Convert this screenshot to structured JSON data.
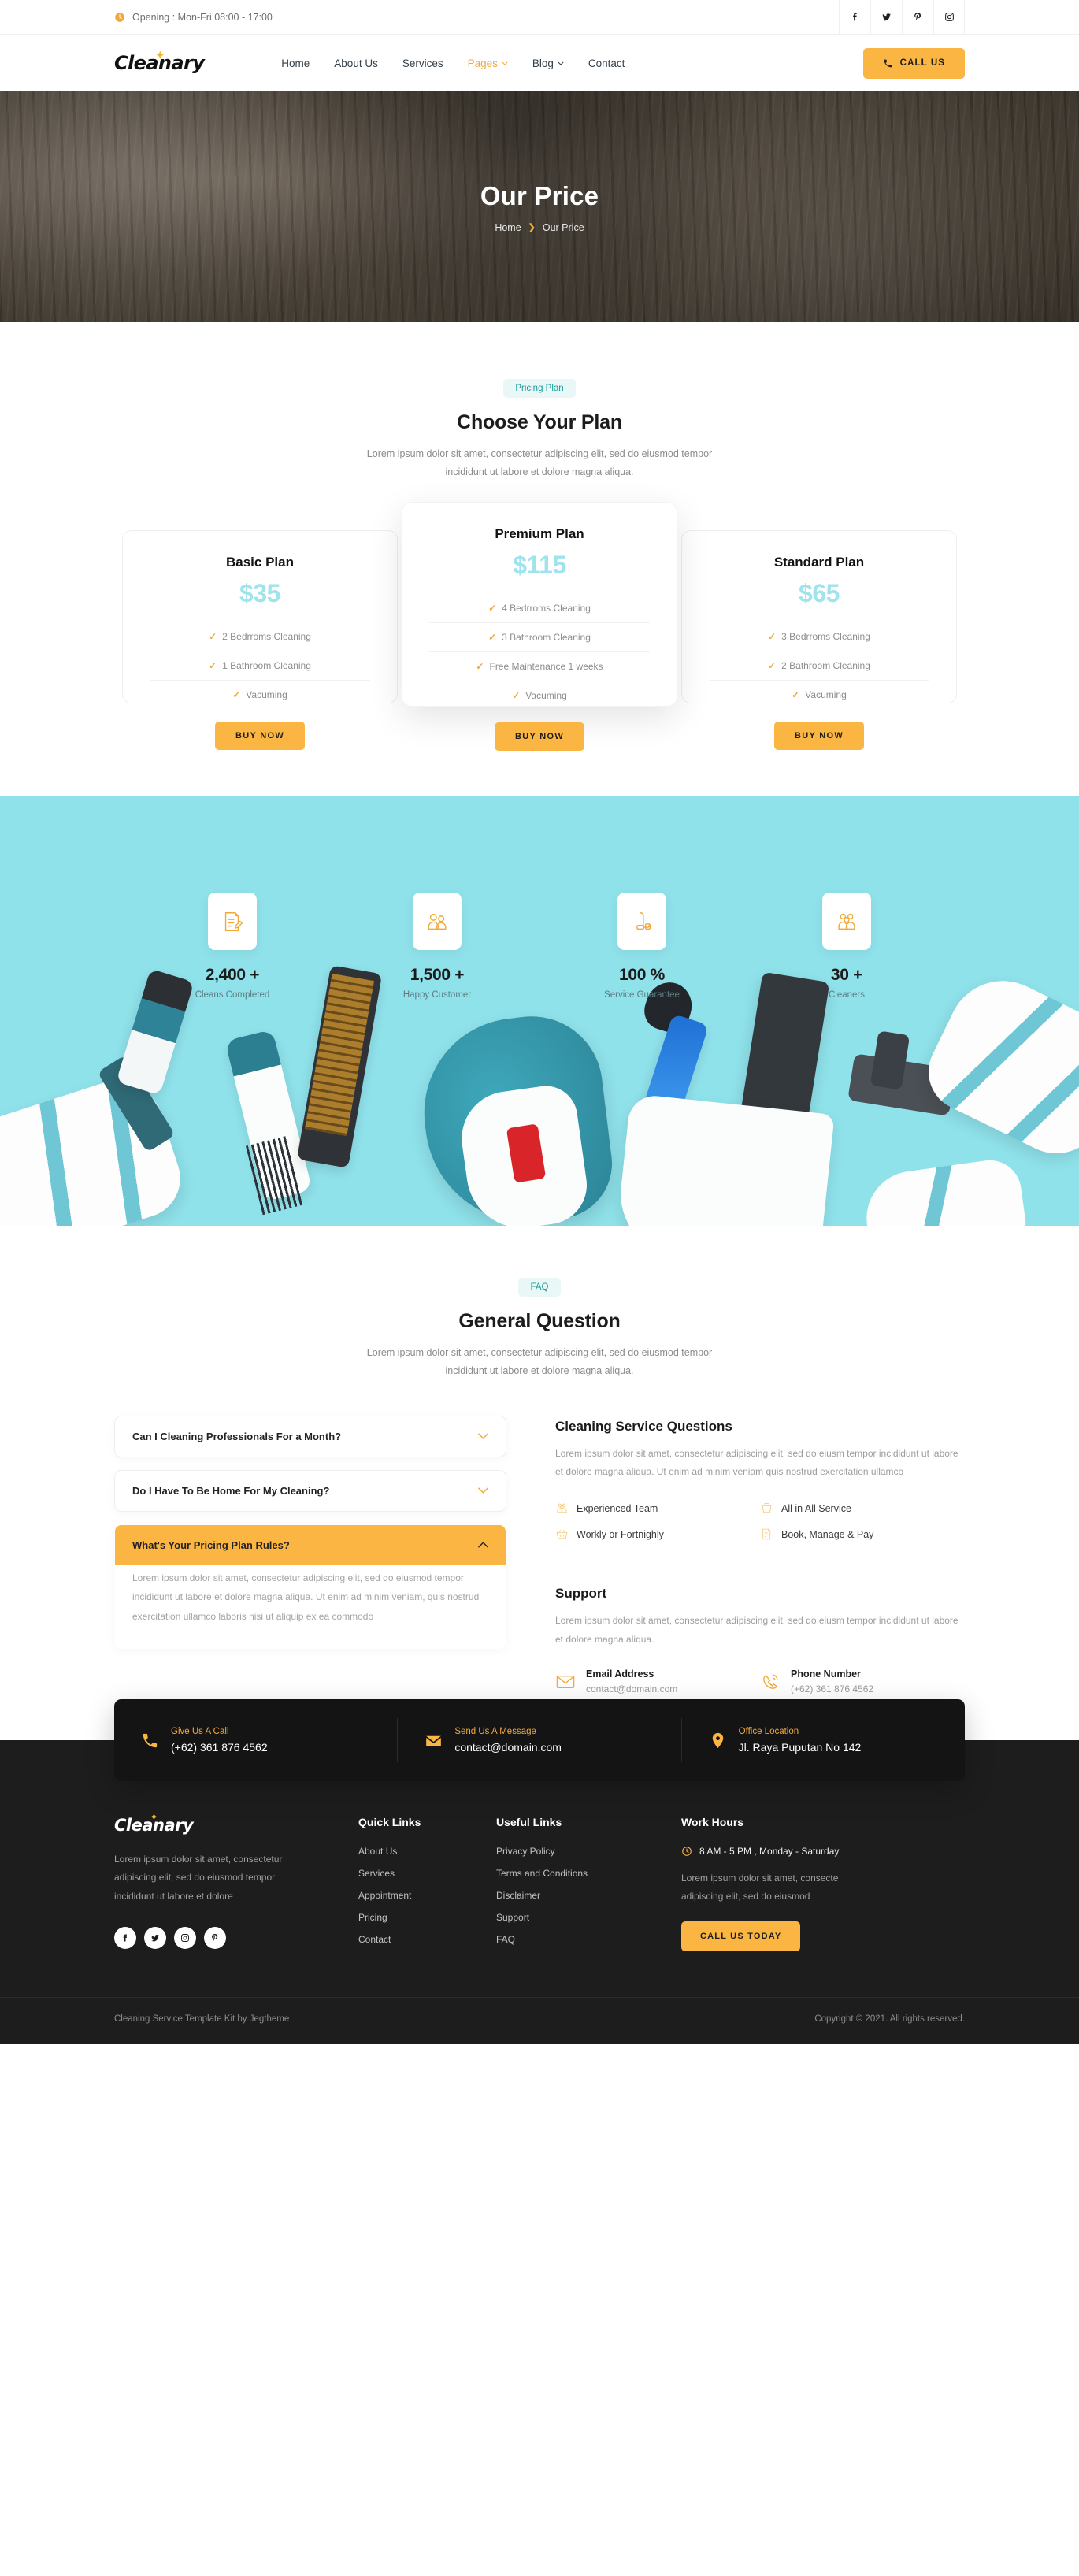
{
  "topbar": {
    "opening": "Opening : Mon-Fri 08:00 - 17:00",
    "clock_icon": "clock-icon",
    "social": [
      {
        "name": "facebook-icon",
        "label": "Facebook"
      },
      {
        "name": "twitter-icon",
        "label": "Twitter"
      },
      {
        "name": "pinterest-icon",
        "label": "Pinterest"
      },
      {
        "name": "instagram-icon",
        "label": "Instagram"
      }
    ]
  },
  "nav": {
    "logo": "Cleanary",
    "links": [
      {
        "label": "Home",
        "active": false,
        "caret": false
      },
      {
        "label": "About Us",
        "active": false,
        "caret": false
      },
      {
        "label": "Services",
        "active": false,
        "caret": false
      },
      {
        "label": "Pages",
        "active": true,
        "caret": true
      },
      {
        "label": "Blog",
        "active": false,
        "caret": true
      },
      {
        "label": "Contact",
        "active": false,
        "caret": false
      }
    ],
    "cta_label": "CALL US",
    "cta_icon": "phone-icon"
  },
  "hero": {
    "title": "Our Price",
    "breadcrumb_home": "Home",
    "breadcrumb_sep": "❯",
    "breadcrumb_current": "Our Price"
  },
  "pricing": {
    "pill": "Pricing Plan",
    "title": "Choose Your Plan",
    "subtitle": "Lorem ipsum dolor sit amet, consectetur adipiscing elit, sed do eiusmod tempor incididunt ut labore et dolore magna aliqua.",
    "plans": [
      {
        "name": "Basic Plan",
        "price": "$35",
        "features": [
          "2 Bedrroms Cleaning",
          "1 Bathroom Cleaning",
          "Vacuming"
        ],
        "button": "BUY NOW",
        "featured": false
      },
      {
        "name": "Premium Plan",
        "price": "$115",
        "features": [
          "4 Bedrroms Cleaning",
          "3 Bathroom Cleaning",
          "Free Maintenance 1 weeks",
          "Vacuming"
        ],
        "button": "BUY NOW",
        "featured": true
      },
      {
        "name": "Standard Plan",
        "price": "$65",
        "features": [
          "3 Bedrroms Cleaning",
          "2 Bathroom Cleaning",
          "Vacuming"
        ],
        "button": "BUY NOW",
        "featured": false
      }
    ]
  },
  "stats": [
    {
      "icon": "checklist-icon",
      "number": "2,400 +",
      "label": "Cleans Completed"
    },
    {
      "icon": "customers-icon",
      "number": "1,500 +",
      "label": "Happy Customer"
    },
    {
      "icon": "vacuum-icon",
      "number": "100 %",
      "label": "Service Guarantee"
    },
    {
      "icon": "team-icon",
      "number": "30 +",
      "label": "Cleaners"
    }
  ],
  "faq": {
    "pill": "FAQ",
    "title": "General Question",
    "subtitle": "Lorem ipsum dolor sit amet, consectetur adipiscing elit, sed do eiusmod tempor incididunt ut labore et dolore magna aliqua.",
    "items": [
      {
        "question": "Can I Cleaning Professionals For a Month?",
        "open": false,
        "answer": ""
      },
      {
        "question": "Do I Have To Be Home For My Cleaning?",
        "open": false,
        "answer": ""
      },
      {
        "question": "What's Your Pricing Plan Rules?",
        "open": true,
        "answer": "Lorem ipsum dolor sit amet, consectetur adipiscing elit, sed do eiusmod tempor incididunt ut labore et dolore magna aliqua. Ut enim ad minim veniam, quis nostrud exercitation ullamco laboris nisi ut aliquip ex ea commodo"
      }
    ],
    "right": {
      "heading": "Cleaning Service Questions",
      "paragraph": "Lorem ipsum dolor sit amet, consectetur adipiscing elit, sed do eiusm tempor incididunt ut labore et dolore magna aliqua. Ut enim ad minim veniam quis nostrud exercitation ullamco",
      "features": [
        {
          "icon": "team-icon",
          "label": "Experienced Team"
        },
        {
          "icon": "bucket-icon",
          "label": "All in All Service"
        },
        {
          "icon": "basket-icon",
          "label": "Workly or Fortnighly"
        },
        {
          "icon": "checklist-icon",
          "label": "Book, Manage & Pay"
        }
      ],
      "support_heading": "Support",
      "support_paragraph": "Lorem ipsum dolor sit amet, consectetur adipiscing elit, sed do eiusm tempor incididunt ut labore et dolore magna aliqua.",
      "contacts": [
        {
          "icon": "mail-icon",
          "title": "Email Address",
          "value": "contact@domain.com"
        },
        {
          "icon": "phone-ring-icon",
          "title": "Phone Number",
          "value": "(+62) 361 876 4562"
        }
      ]
    }
  },
  "cta_bar": [
    {
      "icon": "phone-icon",
      "title": "Give Us A Call",
      "value": "(+62) 361 876 4562"
    },
    {
      "icon": "mail-icon",
      "title": "Send Us A Message",
      "value": "contact@domain.com"
    },
    {
      "icon": "location-pin-icon",
      "title": "Office Location",
      "value": "Jl. Raya Puputan No 142"
    }
  ],
  "footer": {
    "logo": "Cleanary",
    "description": "Lorem ipsum dolor sit amet, consectetur adipiscing elit, sed do eiusmod tempor incididunt ut labore et dolore",
    "social": [
      {
        "name": "facebook-icon",
        "label": "Facebook"
      },
      {
        "name": "twitter-icon",
        "label": "Twitter"
      },
      {
        "name": "instagram-icon",
        "label": "Instagram"
      },
      {
        "name": "pinterest-icon",
        "label": "Pinterest"
      }
    ],
    "quick_links": {
      "heading": "Quick Links",
      "items": [
        "About Us",
        "Services",
        "Appointment",
        "Pricing",
        "Contact"
      ]
    },
    "useful_links": {
      "heading": "Useful Links",
      "items": [
        "Privacy Policy",
        "Terms and Conditions",
        "Disclaimer",
        "Support",
        "FAQ"
      ]
    },
    "work_hours": {
      "heading": "Work Hours",
      "hours": "8 AM - 5 PM , Monday - Saturday",
      "hours_icon": "clock-icon",
      "description": "Lorem ipsum dolor sit amet, consecte adipiscing elit, sed do eiusmod",
      "button": "CALL US TODAY"
    },
    "credit": "Cleaning Service Template Kit by Jegtheme",
    "copyright": "Copyright © 2021. All rights reserved."
  },
  "colors": {
    "accent": "#fbb542",
    "price": "#9fe3ec",
    "teal_pill_bg": "#e9f8f7",
    "teal_pill_text": "#1a9b9b",
    "stats_bg": "#8fe1ea",
    "footer_bg": "#1d1d1d"
  }
}
